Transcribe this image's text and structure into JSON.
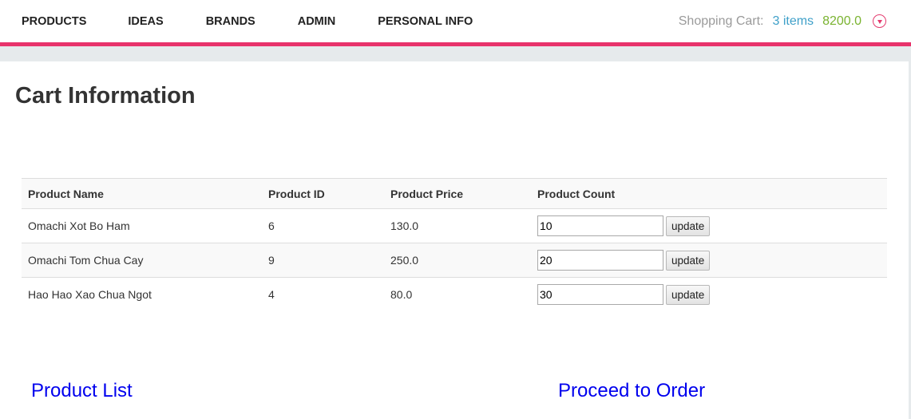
{
  "nav": {
    "items": [
      "PRODUCTS",
      "IDEAS",
      "BRANDS",
      "ADMIN",
      "PERSONAL INFO"
    ]
  },
  "cart_summary": {
    "label": "Shopping Cart:",
    "items_text": "3 items",
    "total": "8200.0",
    "toggle_icon": "chevron-down-circle-icon"
  },
  "page": {
    "title": "Cart Information"
  },
  "table": {
    "headers": [
      "Product Name",
      "Product ID",
      "Product Price",
      "Product Count"
    ],
    "rows": [
      {
        "name": "Omachi Xot Bo Ham",
        "id": "6",
        "price": "130.0",
        "count": "10",
        "button": "update"
      },
      {
        "name": "Omachi Tom Chua Cay",
        "id": "9",
        "price": "250.0",
        "count": "20",
        "button": "update"
      },
      {
        "name": "Hao Hao Xao Chua Ngot",
        "id": "4",
        "price": "80.0",
        "count": "30",
        "button": "update"
      }
    ]
  },
  "links": {
    "product_list": "Product List",
    "proceed": "Proceed to Order"
  },
  "colors": {
    "accent_bar": "#e8336b",
    "cart_items": "#3fa0c9",
    "cart_total": "#7ab330",
    "link": "#0000ee"
  }
}
